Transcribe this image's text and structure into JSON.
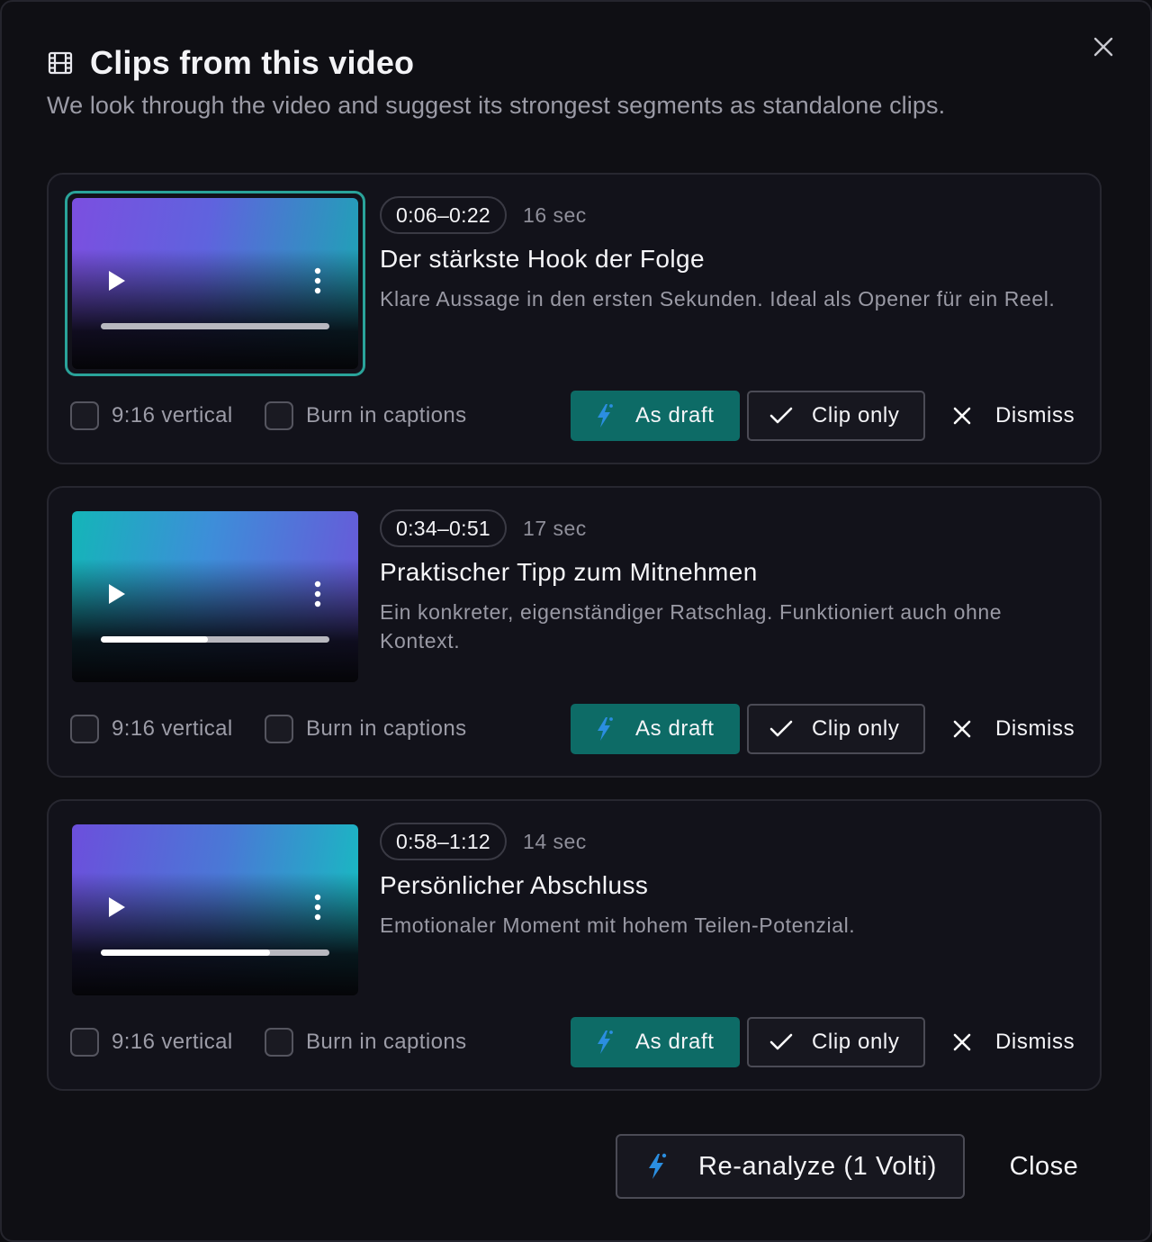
{
  "dialog": {
    "title": "Clips from this video",
    "subtitle": "We look through the video and suggest its strongest segments as standalone clips.",
    "title_icon": "film-icon",
    "close_icon": "close-icon"
  },
  "colors": {
    "accent": "#0d6b66",
    "selected_border": "#2aa39a",
    "background": "#0f0f14",
    "card": "#12121a"
  },
  "clips": [
    {
      "time_range": "0:06–0:22",
      "duration": "16 sec",
      "title": "Der stärkste Hook der Folge",
      "description": "Klare Aussage in den ersten Sekunden. Ideal als Opener für ein Reel.",
      "selected": true,
      "progress": 0,
      "vertical_label": "9:16 vertical",
      "vertical_checked": false,
      "captions_label": "Burn in captions",
      "captions_checked": false,
      "draft_label": "As draft",
      "clip_only_label": "Clip only",
      "dismiss_label": "Dismiss"
    },
    {
      "time_range": "0:34–0:51",
      "duration": "17 sec",
      "title": "Praktischer Tipp zum Mitnehmen",
      "description": "Ein konkreter, eigenständiger Ratschlag. Funktioniert auch ohne Kontext.",
      "selected": false,
      "progress": 0.47,
      "vertical_label": "9:16 vertical",
      "vertical_checked": false,
      "captions_label": "Burn in captions",
      "captions_checked": false,
      "draft_label": "As draft",
      "clip_only_label": "Clip only",
      "dismiss_label": "Dismiss"
    },
    {
      "time_range": "0:58–1:12",
      "duration": "14 sec",
      "title": "Persönlicher Abschluss",
      "description": "Emotionaler Moment mit hohem Teilen-Potenzial.",
      "selected": false,
      "progress": 0.74,
      "vertical_label": "9:16 vertical",
      "vertical_checked": false,
      "captions_label": "Burn in captions",
      "captions_checked": false,
      "draft_label": "As draft",
      "clip_only_label": "Clip only",
      "dismiss_label": "Dismiss"
    }
  ],
  "footer": {
    "reanalyze_label": "Re-analyze (1 Volti)",
    "close_label": "Close"
  },
  "icons": {
    "draft": "lightning-icon",
    "clip_only": "check-icon",
    "dismiss": "close-icon",
    "play": "play-icon",
    "more": "more-vertical-icon"
  }
}
